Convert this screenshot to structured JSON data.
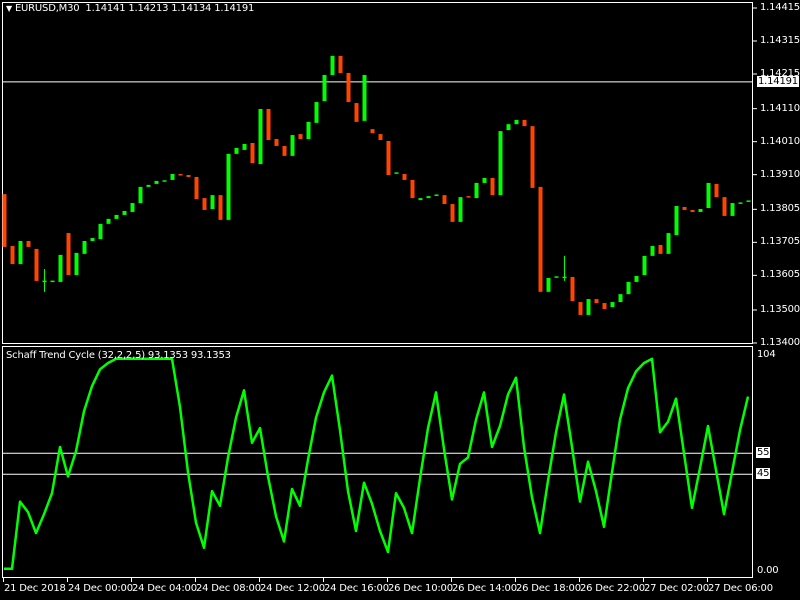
{
  "header": {
    "symbol_timeframe": "EURUSD,M30",
    "ohlc": "1.14141 1.14213 1.14134 1.14191",
    "menu_icon": "triangle-down-icon"
  },
  "indicator": {
    "title": "Schaff Trend Cycle (32,2,2,5) 93.1353 93.1353",
    "levels": [
      55,
      45
    ],
    "level_labels": [
      "55",
      "45"
    ],
    "scale_labels": [
      "104",
      "0.00"
    ],
    "range": [
      0,
      104
    ],
    "line_color": "#00ff00"
  },
  "price_axis": {
    "ticks": [
      "1.14415",
      "1.14315",
      "1.14215",
      "1.14110",
      "1.14010",
      "1.13910",
      "1.13805",
      "1.13705",
      "1.13605",
      "1.13500",
      "1.13400"
    ],
    "current_price": "1.14191"
  },
  "time_axis": {
    "labels": [
      "21 Dec 2018",
      "24 Dec 00:00",
      "24 Dec 04:00",
      "24 Dec 08:00",
      "24 Dec 12:00",
      "24 Dec 16:00",
      "26 Dec 10:00",
      "26 Dec 14:00",
      "26 Dec 18:00",
      "26 Dec 22:00",
      "27 Dec 02:00",
      "27 Dec 06:00"
    ]
  },
  "colors": {
    "background": "#000000",
    "bull": "#00ff00",
    "bear": "#ff4500",
    "axis": "#ffffff"
  },
  "chart_data": [
    {
      "type": "candlestick",
      "title": "EURUSD,M30",
      "ylim": [
        1.134,
        1.14415
      ],
      "grid": false,
      "ohlc": [
        [
          1.13851,
          1.13851,
          1.13691,
          1.13691
        ],
        [
          1.13694,
          1.13694,
          1.13639,
          1.13639
        ],
        [
          1.13639,
          1.13709,
          1.13639,
          1.13709
        ],
        [
          1.13709,
          1.13709,
          1.13691,
          1.13691
        ],
        [
          1.13685,
          1.13685,
          1.13588,
          1.13588
        ],
        [
          1.13588,
          1.13624,
          1.13555,
          1.13589
        ],
        [
          1.13588,
          1.13588,
          1.13587,
          1.13589
        ],
        [
          1.13585,
          1.13667,
          1.13585,
          1.13667
        ],
        [
          1.13733,
          1.13733,
          1.13606,
          1.13606
        ],
        [
          1.13606,
          1.13673,
          1.13606,
          1.13673
        ],
        [
          1.1367,
          1.13709,
          1.1367,
          1.13709
        ],
        [
          1.13709,
          1.13718,
          1.13709,
          1.13718
        ],
        [
          1.13715,
          1.13761,
          1.13715,
          1.13761
        ],
        [
          1.13761,
          1.13776,
          1.13761,
          1.13776
        ],
        [
          1.13776,
          1.13788,
          1.13776,
          1.13788
        ],
        [
          1.13788,
          1.138,
          1.13788,
          1.138
        ],
        [
          1.13797,
          1.13824,
          1.13797,
          1.13824
        ],
        [
          1.13824,
          1.13873,
          1.13824,
          1.13873
        ],
        [
          1.13873,
          1.13879,
          1.13873,
          1.13879
        ],
        [
          1.13882,
          1.13891,
          1.13882,
          1.13891
        ],
        [
          1.13891,
          1.13893,
          1.13891,
          1.13893
        ],
        [
          1.13894,
          1.13912,
          1.13894,
          1.13912
        ],
        [
          1.13912,
          1.13912,
          1.1391,
          1.1391
        ],
        [
          1.13909,
          1.13909,
          1.13903,
          1.13903
        ],
        [
          1.13903,
          1.13903,
          1.13836,
          1.13836
        ],
        [
          1.13839,
          1.13839,
          1.13803,
          1.13803
        ],
        [
          1.13806,
          1.13848,
          1.13806,
          1.13848
        ],
        [
          1.13848,
          1.13848,
          1.13773,
          1.13773
        ],
        [
          1.13773,
          1.13973,
          1.13773,
          1.13973
        ],
        [
          1.13973,
          1.13991,
          1.13973,
          1.13991
        ],
        [
          1.13985,
          1.14003,
          1.13985,
          1.14003
        ],
        [
          1.14006,
          1.14006,
          1.13945,
          1.13945
        ],
        [
          1.13942,
          1.14109,
          1.13942,
          1.14109
        ],
        [
          1.14109,
          1.14109,
          1.14015,
          1.14015
        ],
        [
          1.14018,
          1.14018,
          1.13997,
          1.13997
        ],
        [
          1.13997,
          1.13997,
          1.13967,
          1.13967
        ],
        [
          1.13967,
          1.1403,
          1.13967,
          1.1403
        ],
        [
          1.14033,
          1.14033,
          1.14018,
          1.14018
        ],
        [
          1.14018,
          1.1407,
          1.14018,
          1.1407
        ],
        [
          1.14067,
          1.1413,
          1.14067,
          1.1413
        ],
        [
          1.14133,
          1.14212,
          1.14133,
          1.14212
        ],
        [
          1.14212,
          1.1427,
          1.14212,
          1.1427
        ],
        [
          1.1427,
          1.1427,
          1.14218,
          1.14218
        ],
        [
          1.14218,
          1.14218,
          1.1413,
          1.1413
        ],
        [
          1.14127,
          1.14127,
          1.1407,
          1.1407
        ],
        [
          1.14073,
          1.14212,
          1.14073,
          1.14212
        ],
        [
          1.14048,
          1.14048,
          1.14036,
          1.14036
        ],
        [
          1.14033,
          1.14033,
          1.14015,
          1.14015
        ],
        [
          1.14012,
          1.14012,
          1.13909,
          1.13909
        ],
        [
          1.13915,
          1.13917,
          1.13915,
          1.13917
        ],
        [
          1.13912,
          1.13912,
          1.13894,
          1.13894
        ],
        [
          1.13894,
          1.13894,
          1.13839,
          1.13839
        ],
        [
          1.13833,
          1.13839,
          1.13833,
          1.13839
        ],
        [
          1.13839,
          1.13845,
          1.13839,
          1.13845
        ],
        [
          1.13848,
          1.1385,
          1.13848,
          1.1385
        ],
        [
          1.13848,
          1.13848,
          1.13821,
          1.13821
        ],
        [
          1.13821,
          1.13821,
          1.13767,
          1.13767
        ],
        [
          1.13767,
          1.13842,
          1.13767,
          1.13842
        ],
        [
          1.13845,
          1.13845,
          1.13843,
          1.13843
        ],
        [
          1.13839,
          1.13885,
          1.13839,
          1.13885
        ],
        [
          1.13885,
          1.139,
          1.13885,
          1.139
        ],
        [
          1.139,
          1.139,
          1.13848,
          1.13848
        ],
        [
          1.13848,
          1.14042,
          1.13848,
          1.14042
        ],
        [
          1.14045,
          1.14063,
          1.14045,
          1.14063
        ],
        [
          1.14063,
          1.14076,
          1.14063,
          1.14076
        ],
        [
          1.14076,
          1.14076,
          1.14057,
          1.14057
        ],
        [
          1.14057,
          1.14057,
          1.1387,
          1.1387
        ],
        [
          1.13873,
          1.13873,
          1.13555,
          1.13555
        ],
        [
          1.13555,
          1.13597,
          1.13555,
          1.13597
        ],
        [
          1.136,
          1.13602,
          1.136,
          1.13602
        ],
        [
          1.136,
          1.13664,
          1.13588,
          1.13601
        ],
        [
          1.136,
          1.136,
          1.13527,
          1.13527
        ],
        [
          1.13524,
          1.13524,
          1.13485,
          1.13485
        ],
        [
          1.13485,
          1.13533,
          1.13485,
          1.13533
        ],
        [
          1.13533,
          1.13533,
          1.13521,
          1.13521
        ],
        [
          1.13521,
          1.13521,
          1.13503,
          1.13503
        ],
        [
          1.13509,
          1.13524,
          1.13509,
          1.13524
        ],
        [
          1.13524,
          1.13548,
          1.13524,
          1.13548
        ],
        [
          1.13548,
          1.13585,
          1.13548,
          1.13585
        ],
        [
          1.13585,
          1.13603,
          1.13585,
          1.13603
        ],
        [
          1.13606,
          1.13664,
          1.13606,
          1.13664
        ],
        [
          1.13664,
          1.13694,
          1.13664,
          1.13694
        ],
        [
          1.13697,
          1.13697,
          1.1367,
          1.1367
        ],
        [
          1.1367,
          1.13733,
          1.1367,
          1.13733
        ],
        [
          1.13727,
          1.13815,
          1.13727,
          1.13815
        ],
        [
          1.13812,
          1.13812,
          1.13803,
          1.13803
        ],
        [
          1.13803,
          1.13803,
          1.13797,
          1.13797
        ],
        [
          1.13797,
          1.13806,
          1.13797,
          1.13806
        ],
        [
          1.13809,
          1.13885,
          1.13809,
          1.13885
        ],
        [
          1.13882,
          1.13882,
          1.13842,
          1.13842
        ],
        [
          1.13842,
          1.13842,
          1.13785,
          1.13785
        ],
        [
          1.13785,
          1.13824,
          1.13785,
          1.13824
        ],
        [
          1.13824,
          1.13826,
          1.13824,
          1.13826
        ],
        [
          1.1383,
          1.13832,
          1.1383,
          1.13832
        ]
      ],
      "current_price": 1.14191
    },
    {
      "type": "line",
      "title": "Schaff Trend Cycle (32,2,2,5) 93.1353 93.1353",
      "ylim": [
        0,
        104
      ],
      "values": [
        0,
        0,
        32,
        27,
        17,
        26,
        36,
        58,
        44,
        56,
        75,
        87,
        95,
        98,
        100,
        100,
        100,
        100,
        100,
        100,
        100,
        100,
        77,
        46,
        22,
        10,
        37,
        30,
        53,
        72,
        85,
        60,
        67,
        44,
        25,
        13,
        38,
        30,
        52,
        72,
        84,
        92,
        66,
        37,
        18,
        41,
        31,
        18,
        8,
        36,
        29,
        17,
        43,
        67,
        84,
        57,
        33,
        50,
        53,
        71,
        84,
        58,
        68,
        83,
        91,
        58,
        34,
        17,
        42,
        65,
        83,
        58,
        32,
        51,
        37,
        20,
        46,
        71,
        86,
        94,
        98,
        100,
        65,
        70,
        81,
        55,
        29,
        48,
        68,
        47,
        26,
        46,
        66,
        82
      ]
    }
  ]
}
